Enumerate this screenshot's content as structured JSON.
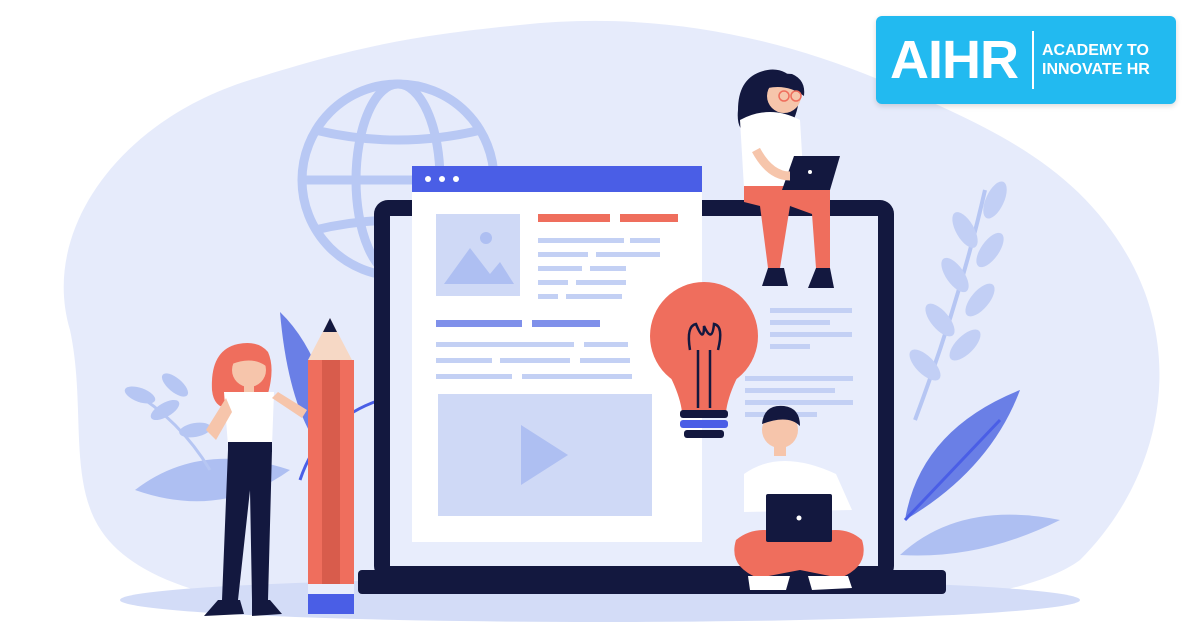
{
  "brand": {
    "name": "AIHR",
    "tagline_line1": "ACADEMY TO",
    "tagline_line2": "INNOVATE HR",
    "background_color": "#22baf0",
    "text_color": "#ffffff"
  },
  "illustration": {
    "subject": "team-creating-web-content",
    "palette": {
      "backdrop": "#e3e9fb",
      "blob": "#c9d5f6",
      "accent_blue": "#4a5ee6",
      "coral": "#ef6e5d",
      "navy": "#13183f",
      "light_block": "#c3d0f4"
    }
  }
}
